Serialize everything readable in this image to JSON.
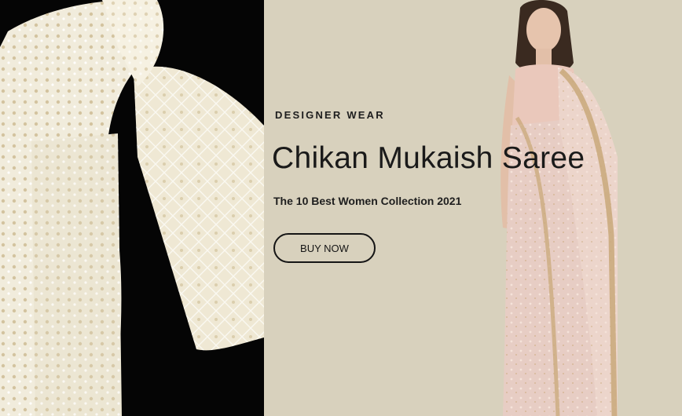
{
  "hero": {
    "eyebrow": "DESIGNER WEAR",
    "title": "Chikan Mukaish Saree",
    "subtitle": "The 10 Best Women Collection 2021",
    "cta_label": "BUY NOW"
  },
  "colors": {
    "background": "#d8d1bd",
    "text": "#1a1a1a",
    "left_image_bg": "#050505",
    "saree_cream": "#f1ecdc",
    "saree_pink": "#e7cdc4",
    "gold_border": "#c9a87a"
  }
}
